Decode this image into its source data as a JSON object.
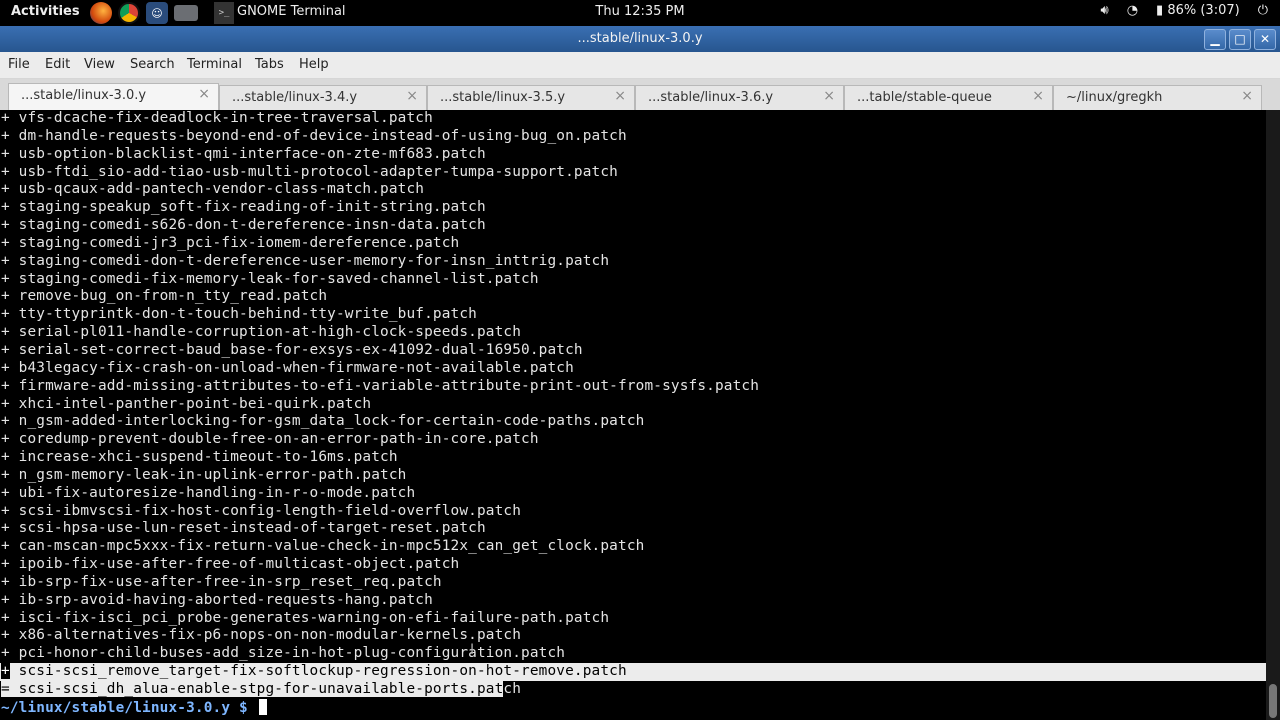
{
  "topbar": {
    "activities": "Activities",
    "app_name": "GNOME Terminal",
    "app_prefix": ">_",
    "clock": "Thu 12:35 PM",
    "battery": "86% (3:07)",
    "icons": [
      "firefox-icon",
      "chrome-icon",
      "people-icon",
      "drive-icon",
      "volume-icon",
      "wifi-icon",
      "battery-icon",
      "power-icon"
    ]
  },
  "window": {
    "title": "...stable/linux-3.0.y",
    "buttons": {
      "minimize": "▁",
      "maximize": "□",
      "close": "✕"
    }
  },
  "menu": {
    "file": "File",
    "edit": "Edit",
    "view": "View",
    "search": "Search",
    "terminal": "Terminal",
    "tabs": "Tabs",
    "help": "Help"
  },
  "tabs": [
    {
      "label": "...stable/linux-3.0.y",
      "active": true
    },
    {
      "label": "...stable/linux-3.4.y",
      "active": false
    },
    {
      "label": "...stable/linux-3.5.y",
      "active": false
    },
    {
      "label": "...stable/linux-3.6.y",
      "active": false
    },
    {
      "label": "...table/stable-queue",
      "active": false
    },
    {
      "label": "~/linux/gregkh",
      "active": false
    }
  ],
  "tab_close": "×",
  "terminal": {
    "lines": [
      "vfs-dcache-fix-deadlock-in-tree-traversal.patch",
      "dm-handle-requests-beyond-end-of-device-instead-of-using-bug_on.patch",
      "usb-option-blacklist-qmi-interface-on-zte-mf683.patch",
      "usb-ftdi_sio-add-tiao-usb-multi-protocol-adapter-tumpa-support.patch",
      "usb-qcaux-add-pantech-vendor-class-match.patch",
      "staging-speakup_soft-fix-reading-of-init-string.patch",
      "staging-comedi-s626-don-t-dereference-insn-data.patch",
      "staging-comedi-jr3_pci-fix-iomem-dereference.patch",
      "staging-comedi-don-t-dereference-user-memory-for-insn_inttrig.patch",
      "staging-comedi-fix-memory-leak-for-saved-channel-list.patch",
      "remove-bug_on-from-n_tty_read.patch",
      "tty-ttyprintk-don-t-touch-behind-tty-write_buf.patch",
      "serial-pl011-handle-corruption-at-high-clock-speeds.patch",
      "serial-set-correct-baud_base-for-exsys-ex-41092-dual-16950.patch",
      "b43legacy-fix-crash-on-unload-when-firmware-not-available.patch",
      "firmware-add-missing-attributes-to-efi-variable-attribute-print-out-from-sysfs.patch",
      "xhci-intel-panther-point-bei-quirk.patch",
      "n_gsm-added-interlocking-for-gsm_data_lock-for-certain-code-paths.patch",
      "coredump-prevent-double-free-on-an-error-path-in-core.patch",
      "increase-xhci-suspend-timeout-to-16ms.patch",
      "n_gsm-memory-leak-in-uplink-error-path.patch",
      "ubi-fix-autoresize-handling-in-r-o-mode.patch",
      "scsi-ibmvscsi-fix-host-config-length-field-overflow.patch",
      "scsi-hpsa-use-lun-reset-instead-of-target-reset.patch",
      "can-mscan-mpc5xxx-fix-return-value-check-in-mpc512x_can_get_clock.patch",
      "ipoib-fix-use-after-free-of-multicast-object.patch",
      "ib-srp-fix-use-after-free-in-srp_reset_req.patch",
      "ib-srp-avoid-having-aborted-requests-hang.patch",
      "isci-fix-isci_pci_probe-generates-warning-on-efi-failure-path.patch",
      "x86-alternatives-fix-p6-nops-on-non-modular-kernels.patch",
      "pci-honor-child-buses-add_size-in-hot-plug-configuration.patch"
    ],
    "line_prefix": "+",
    "highlight_line": "scsi-scsi_remove_target-fix-softlockup-regression-on-hot-remove.patch",
    "eq_prefix": "=",
    "eq_line_hl": "scsi-scsi_dh_alua-enable-stpg-for-unavailable-ports.pat",
    "eq_line_rest": "ch",
    "prompt": "~/linux/stable/linux-3.0.y $"
  }
}
